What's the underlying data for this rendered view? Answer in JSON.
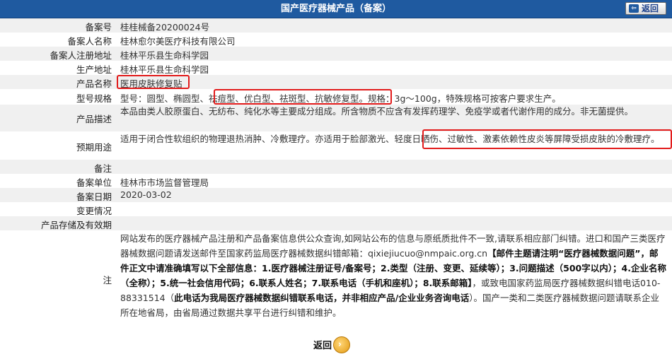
{
  "header": {
    "title": "国产医疗器械产品（备案）",
    "back_label": "返回",
    "back_arrow": "⇦"
  },
  "fields": [
    {
      "label": "备案号",
      "value": "桂桂械备20200024号"
    },
    {
      "label": "备案人名称",
      "value": "桂林愈尔美医疗科技有限公司"
    },
    {
      "label": "备案人注册地址",
      "value": "桂林平乐县生命科学园"
    },
    {
      "label": "生产地址",
      "value": "桂林平乐县生命科学园"
    },
    {
      "label": "产品名称",
      "value": "医用皮肤修复贴"
    },
    {
      "label": "型号规格",
      "value_a": "型号：圆型、椭圆型、",
      "value_b": "祛痘型、优白型、祛斑型、抗敏修复型",
      "value_c": "。规格：3g～100g，特殊规格可按客户要求生产。"
    },
    {
      "label": "产品描述",
      "value": "本品由类人胶原蛋白、无纺布、纯化水等主要成分组成。所含物质不应含有发挥药理学、免疫学或者代谢作用的成分。非无菌提供。"
    },
    {
      "label": "预期用途",
      "value_a": "适用于闭合性软组织的物理退热消肿、冷敷理疗。亦适用于脸部激光、",
      "value_b": "轻度日晒伤、过敏性、激素依赖性皮炎等屏障受损皮肤",
      "value_c": "的冷敷理疗。"
    },
    {
      "label": "备注",
      "value": ""
    },
    {
      "label": "备案单位",
      "value": "桂林市市场监督管理局"
    },
    {
      "label": "备案日期",
      "value": "2020-03-02"
    },
    {
      "label": "变更情况",
      "value": ""
    },
    {
      "label": "产品存储及有效期",
      "value": ""
    }
  ],
  "note": {
    "label": "注",
    "p1": "网站发布的医疗器械产品注册和产品备案信息供公众查询,如网站公布的信息与原纸质批件不一致,请联系相应部门纠错。进口和国产三类医疗器械数据问题请发送邮件至国家药监局医疗器械数据纠错邮箱：qixiejiucuo@nmpaic.org.cn",
    "p2": "【邮件主题请注明“医疗器械数据问题”，邮件正文中请准确填写以下全部信息：1.医疗器械注册证号/备案号；2.类型（注册、变更、延续等）；3.问题描述（500字以内）；4.企业名称（全称）；5.统一社会信用代码；6.联系人姓名；7.联系电话（手机和座机）；8.联系邮箱】",
    "p3": "，或致电国家药监局医疗器械数据纠错电话010-88331514（",
    "p4": "此电话为我局医疗器械数据纠错联系电话，并非相应产品/企业业务咨询电话",
    "p5": "）。国产一类和二类医疗器械数据问题请联系企业所在地省局，由省局通过数据共享平台进行纠错和维护。"
  },
  "footer": {
    "back_label": "返回",
    "back_arrow": "›"
  }
}
